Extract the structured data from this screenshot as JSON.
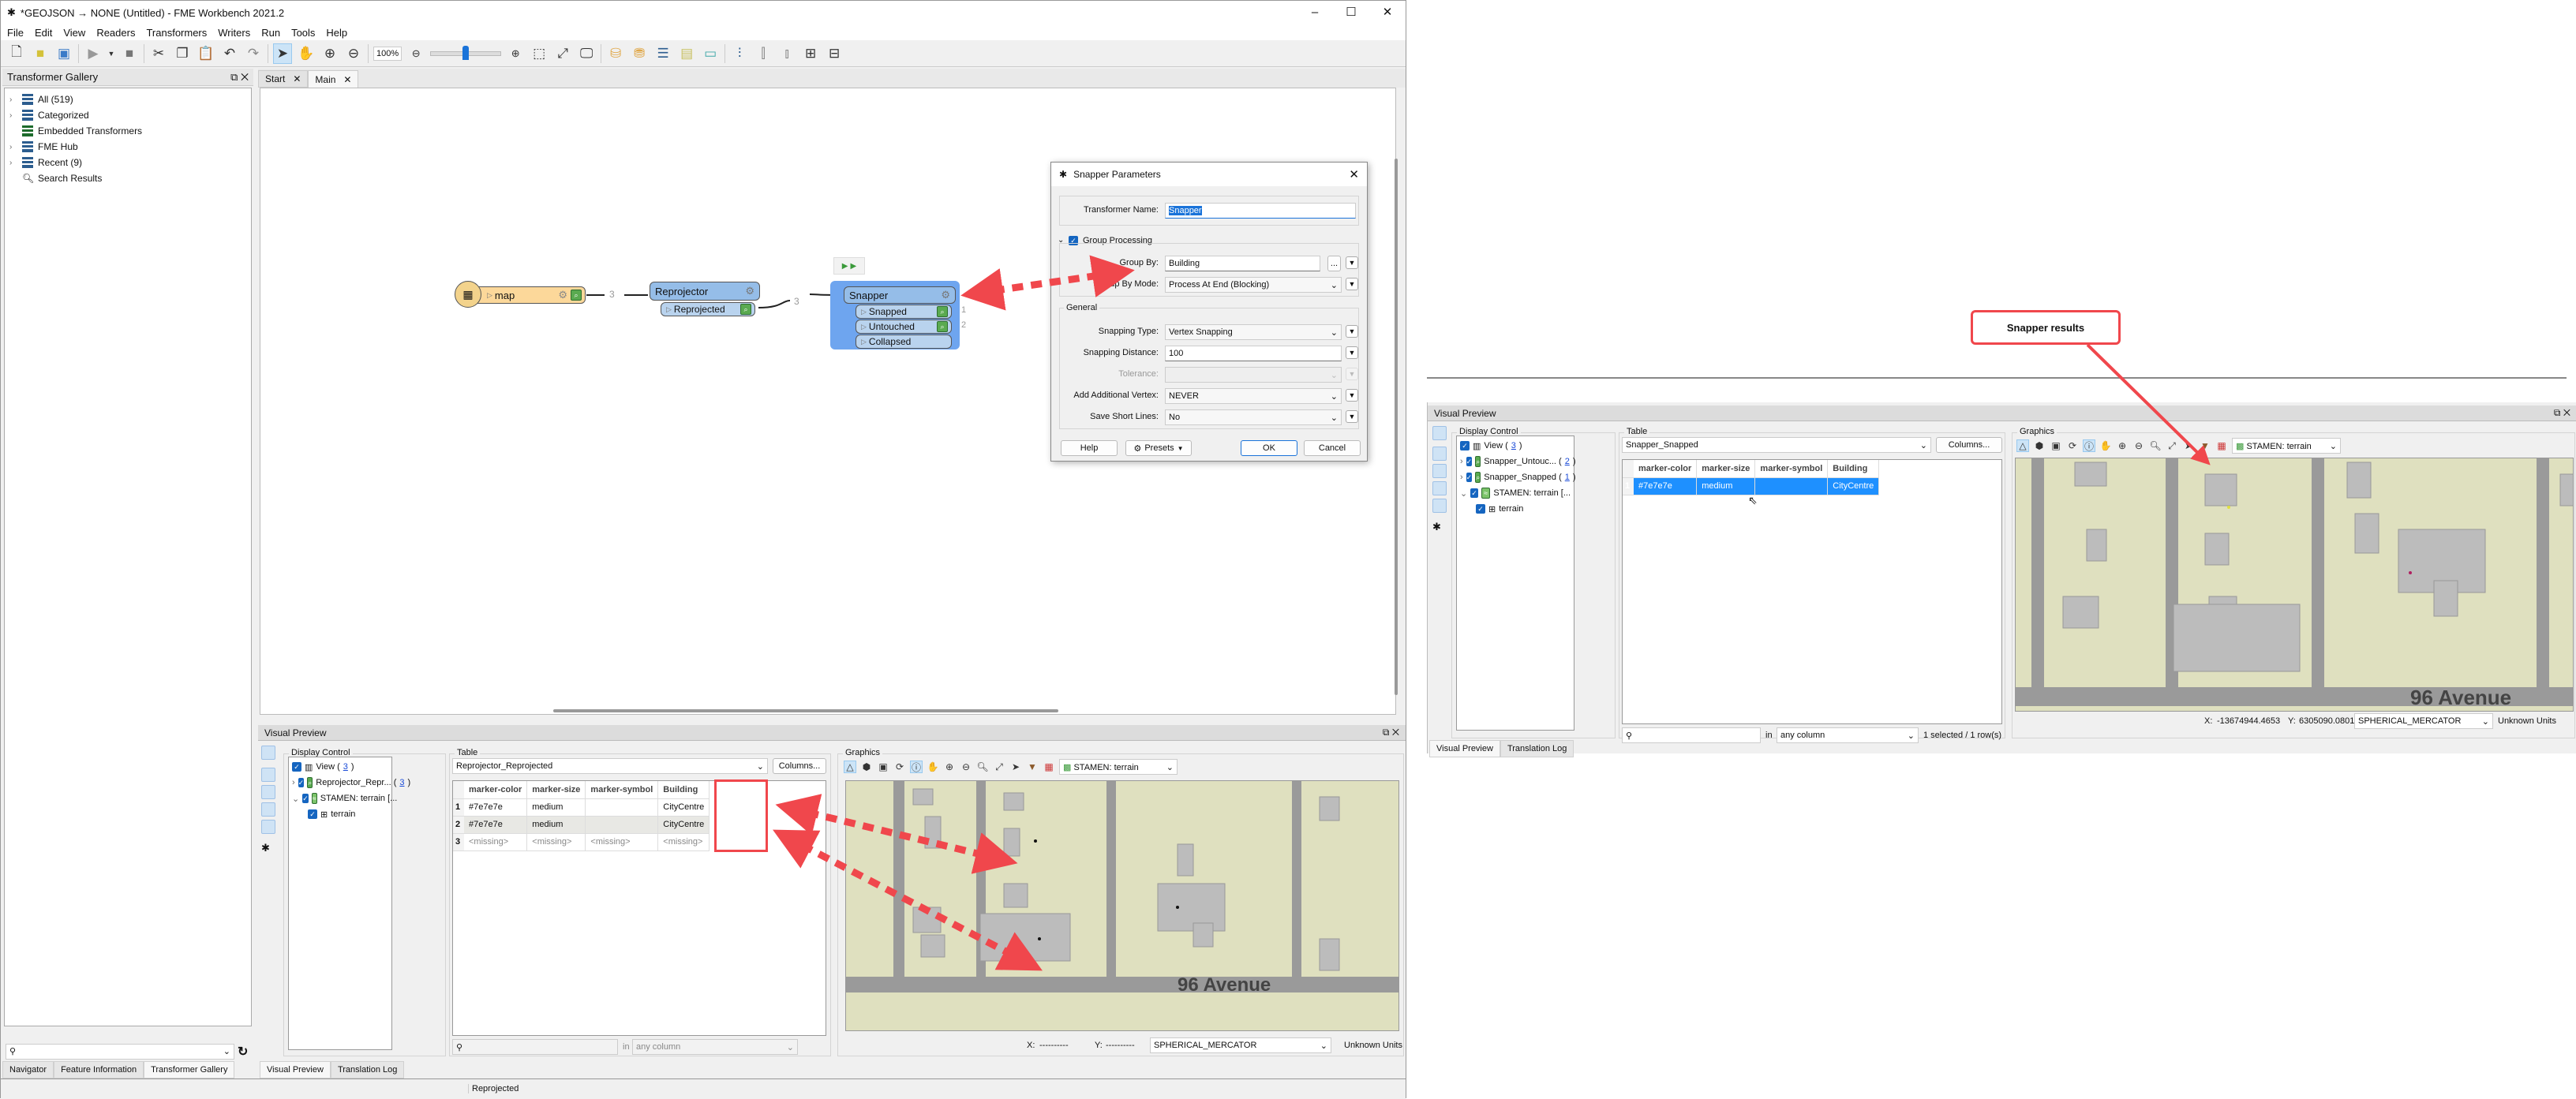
{
  "window": {
    "title": "*GEOJSON → NONE (Untitled) - FME Workbench 2021.2",
    "menu": [
      "File",
      "Edit",
      "View",
      "Readers",
      "Transformers",
      "Writers",
      "Run",
      "Tools",
      "Help"
    ],
    "zoom": "100%"
  },
  "gallery": {
    "title": "Transformer Gallery",
    "items": [
      {
        "label": "All (519)",
        "expandable": true
      },
      {
        "label": "Categorized",
        "expandable": true
      },
      {
        "label": "Embedded Transformers",
        "expandable": false
      },
      {
        "label": "FME Hub",
        "expandable": true
      },
      {
        "label": "Recent (9)",
        "expandable": true
      },
      {
        "label": "Search Results",
        "expandable": false
      }
    ]
  },
  "canvas": {
    "tabs": [
      "Start",
      "Main"
    ],
    "active_tab": "Main",
    "nodes": {
      "reader": {
        "name": "map"
      },
      "reprojector": {
        "name": "Reprojector",
        "port": "Reprojected"
      },
      "snapper": {
        "name": "Snapper",
        "ports": [
          "Snapped",
          "Untouched",
          "Collapsed"
        ],
        "port_counts": [
          "1",
          "2",
          ""
        ]
      }
    },
    "link_counts": [
      "3",
      "3"
    ]
  },
  "dialog": {
    "title": "Snapper Parameters",
    "transformer_name_label": "Transformer Name:",
    "transformer_name": "Snapper",
    "group_processing": "Group Processing",
    "group_by_label": "Group By:",
    "group_by": "Building",
    "group_by_mode_label": "Group By Mode:",
    "group_by_mode": "Process At End (Blocking)",
    "general": "General",
    "snapping_type_label": "Snapping Type:",
    "snapping_type": "Vertex Snapping",
    "snapping_distance_label": "Snapping Distance:",
    "snapping_distance": "100",
    "tolerance_label": "Tolerance:",
    "add_vertex_label": "Add Additional Vertex:",
    "add_vertex": "NEVER",
    "save_short_lines_label": "Save Short Lines:",
    "save_short_lines": "No",
    "ellipsis": "...",
    "help": "Help",
    "presets": "Presets",
    "ok": "OK",
    "cancel": "Cancel"
  },
  "visual_preview": {
    "title": "Visual Preview",
    "display_control": "Display Control",
    "table_label": "Table",
    "graphics_label": "Graphics",
    "view": "View (",
    "view_count": "3",
    "close_paren": ")",
    "layers": [
      {
        "label": "Reprojector_Repr... (",
        "count": "3"
      },
      {
        "label": "STAMEN: terrain [..."
      }
    ],
    "sublayer": "terrain",
    "table_select": "Reprojector_Reprojected",
    "columns_btn": "Columns...",
    "columns": [
      "marker-color",
      "marker-size",
      "marker-symbol",
      "Building"
    ],
    "rows": [
      [
        "1",
        "#7e7e7e",
        "medium",
        "",
        "CityCentre"
      ],
      [
        "2",
        "#7e7e7e",
        "medium",
        "",
        "CityCentre"
      ],
      [
        "3",
        "<missing>",
        "<missing>",
        "<missing>",
        "<missing>"
      ]
    ],
    "search_in": "in",
    "search_scope": "any column",
    "basemap": "STAMEN: terrain",
    "x_label": "X:",
    "x_value": "----------",
    "y_label": "Y:",
    "y_value": "----------",
    "crs": "SPHERICAL_MERCATOR",
    "units": "Unknown Units",
    "map_label": "96 Avenue"
  },
  "bottom_tabs_left": [
    "Navigator",
    "Feature Information",
    "Transformer Gallery"
  ],
  "bottom_tabs_right": [
    "Visual Preview",
    "Translation Log"
  ],
  "status": "Reprojected",
  "result_panel": {
    "callout": "Snapper results",
    "title": "Visual Preview",
    "display_control": "Display Control",
    "table_label": "Table",
    "graphics_label": "Graphics",
    "view": "View (",
    "view_count": "3",
    "close_paren": ")",
    "layers": [
      {
        "label": "Snapper_Untouc... (",
        "count": "2"
      },
      {
        "label": "Snapper_Snapped (",
        "count": "1"
      },
      {
        "label": "STAMEN: terrain [..."
      }
    ],
    "sublayer": "terrain",
    "table_select": "Snapper_Snapped",
    "columns_btn": "Columns...",
    "columns": [
      "marker-color",
      "marker-size",
      "marker-symbol",
      "Building"
    ],
    "rows": [
      [
        "1",
        "#7e7e7e",
        "medium",
        "",
        "CityCentre"
      ]
    ],
    "search_in": "in",
    "search_scope": "any column",
    "selection_status": "1 selected / 1 row(s)",
    "basemap": "STAMEN: terrain",
    "x_label": "X:",
    "x_value": "-13674944.4653",
    "y_label": "Y:",
    "y_value": "6305090.0801",
    "crs": "SPHERICAL_MERCATOR",
    "units": "Unknown Units",
    "map_label": "96 Avenue",
    "tabs": [
      "Visual Preview",
      "Translation Log"
    ]
  },
  "colors": {
    "accent": "#1e90ff",
    "annotation": "#f0474c",
    "reader": "#fcd89a",
    "transformer": "#95bde8",
    "map_bg": "#dfe0bf"
  }
}
